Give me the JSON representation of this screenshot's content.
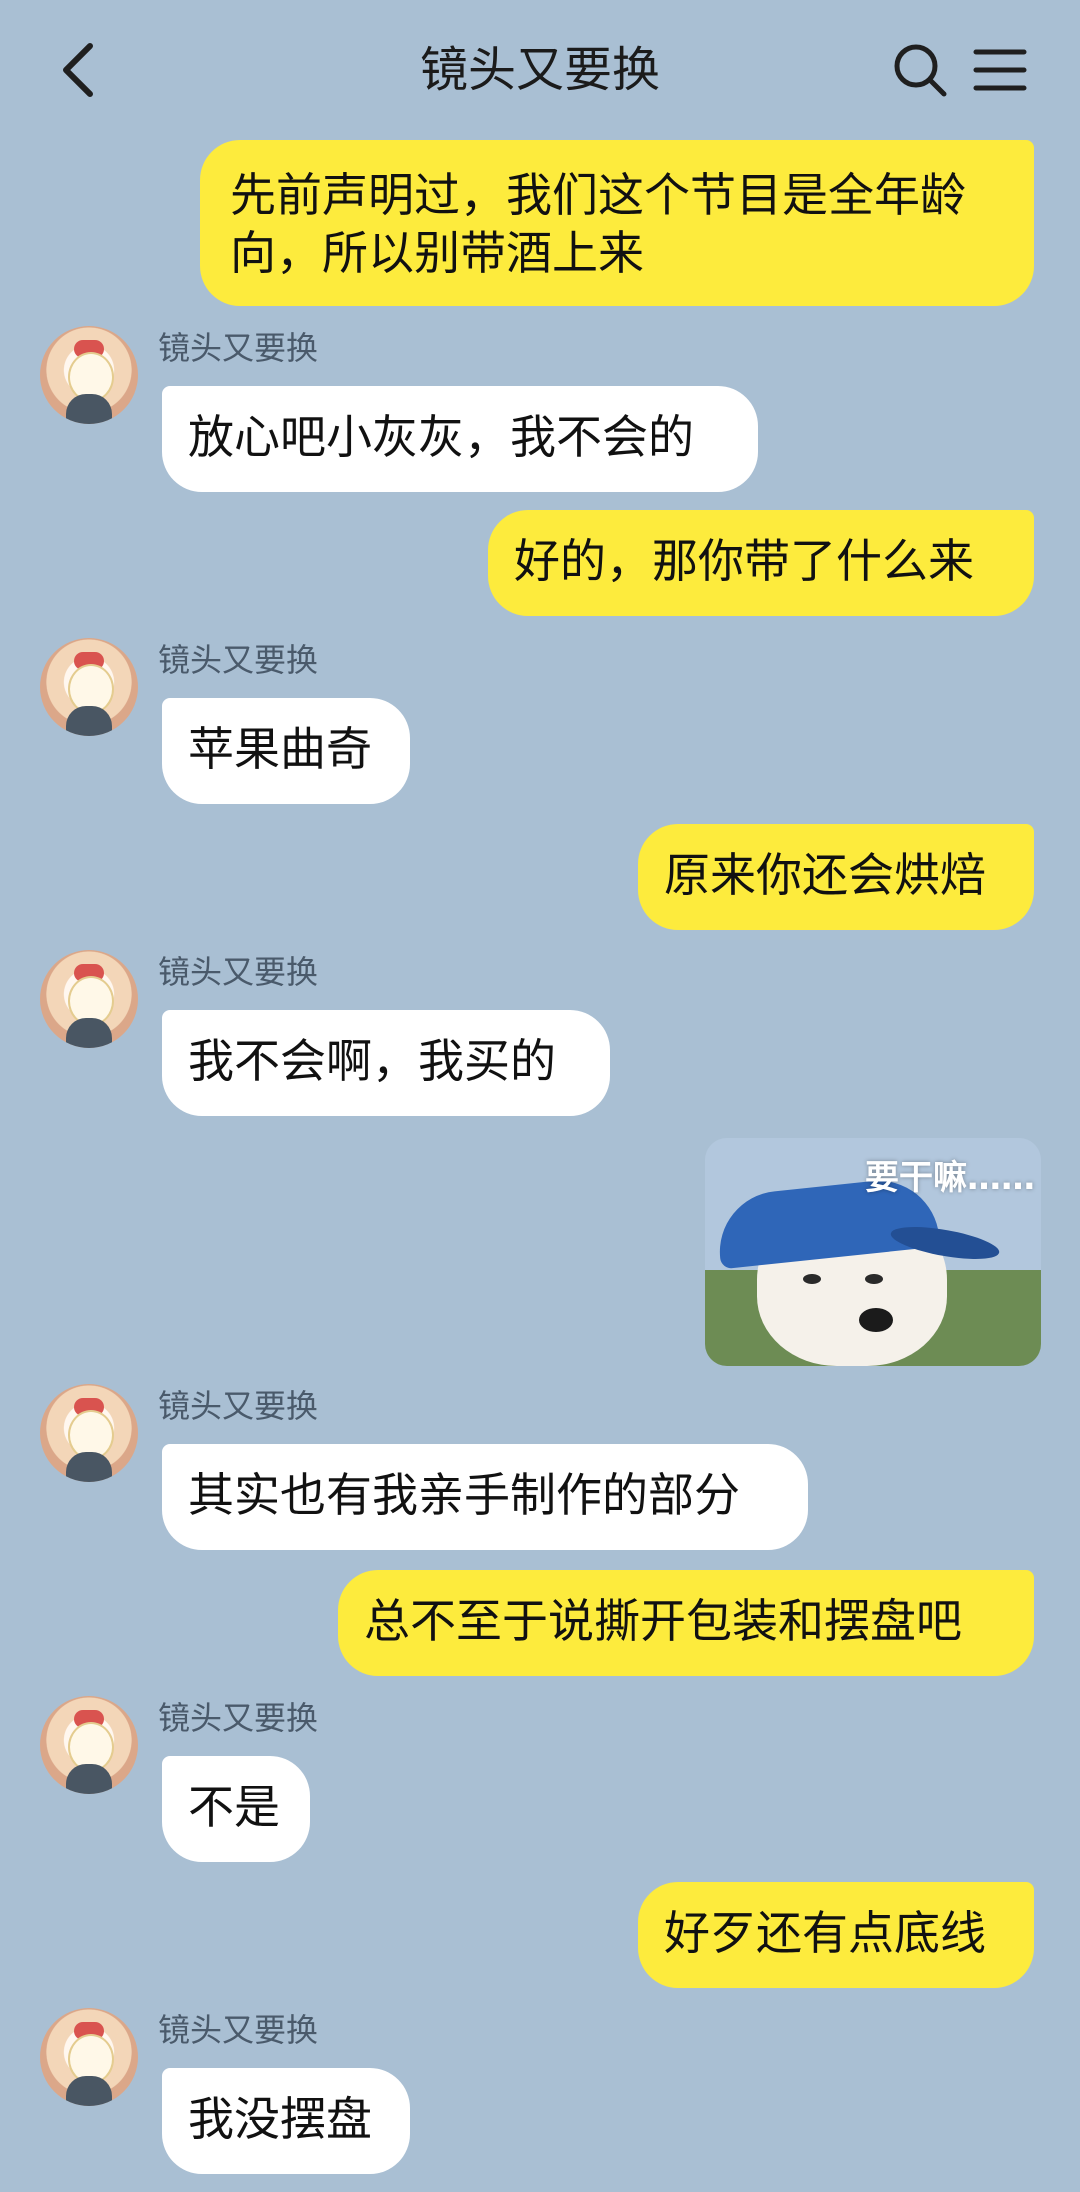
{
  "header": {
    "title": "镜头又要换"
  },
  "chat": {
    "sender_name": "镜头又要换",
    "messages": [
      {
        "side": "right",
        "text": "先前声明过，我们这个节目是全年龄向，所以别带酒上来"
      },
      {
        "side": "left",
        "text": "放心吧小灰灰，我不会的"
      },
      {
        "side": "right",
        "text": "好的，那你带了什么来"
      },
      {
        "side": "left",
        "text": "苹果曲奇"
      },
      {
        "side": "right",
        "text": "原来你还会烘焙"
      },
      {
        "side": "left",
        "text": "我不会啊，我买的"
      },
      {
        "side": "right",
        "type": "sticker",
        "caption": "要干嘛……"
      },
      {
        "side": "left",
        "text": "其实也有我亲手制作的部分"
      },
      {
        "side": "right",
        "text": "总不至于说撕开包装和摆盘吧"
      },
      {
        "side": "left",
        "text": "不是"
      },
      {
        "side": "right",
        "text": "好歹还有点底线"
      },
      {
        "side": "left",
        "text": "我没摆盘"
      }
    ]
  },
  "icons": {
    "back": "back-arrow-icon",
    "search": "search-icon",
    "menu": "menu-icon"
  },
  "colors": {
    "background": "#a9bfd3",
    "outgoing_bubble": "#fdeb3d",
    "incoming_bubble": "#ffffff"
  }
}
